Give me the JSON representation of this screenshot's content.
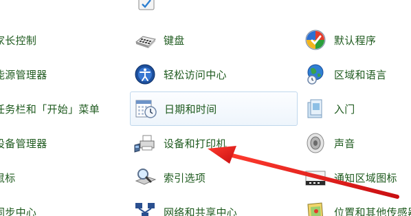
{
  "window": {
    "background": "#ffffff",
    "label_color": "#1e5a1e",
    "highlight_border": "#bfd7ec",
    "arrow_color": "#e0191b"
  },
  "left_column": {
    "items": [
      {
        "label": "家长控制",
        "icon": "parental-controls-icon"
      },
      {
        "label": "能源管理器",
        "icon": "power-manager-icon"
      },
      {
        "label": "任务栏和「开始」菜单",
        "icon": "taskbar-start-menu-icon"
      },
      {
        "label": "设备管理器",
        "icon": "device-manager-icon"
      },
      {
        "label": "鼠标",
        "icon": "mouse-icon"
      },
      {
        "label": "同步中心",
        "icon": "sync-center-icon"
      }
    ]
  },
  "middle_column": {
    "items": [
      {
        "label": "键盘",
        "icon": "keyboard-icon"
      },
      {
        "label": "轻松访问中心",
        "icon": "ease-of-access-icon"
      },
      {
        "label": "日期和时间",
        "icon": "date-time-icon",
        "selected": true
      },
      {
        "label": "设备和打印机",
        "icon": "devices-printers-icon"
      },
      {
        "label": "索引选项",
        "icon": "indexing-options-icon"
      },
      {
        "label": "网络和共享中心",
        "icon": "network-sharing-icon"
      }
    ]
  },
  "right_column": {
    "items": [
      {
        "label": "默认程序",
        "icon": "default-programs-icon"
      },
      {
        "label": "区域和语言",
        "icon": "region-language-icon"
      },
      {
        "label": "入门",
        "icon": "getting-started-icon"
      },
      {
        "label": "声音",
        "icon": "sound-icon"
      },
      {
        "label": "通知区域图标",
        "icon": "notification-area-icon"
      },
      {
        "label": "位置和其他传感器",
        "icon": "location-sensors-icon"
      }
    ]
  },
  "annotation": {
    "type": "arrow",
    "points_to": "设备和打印机"
  }
}
